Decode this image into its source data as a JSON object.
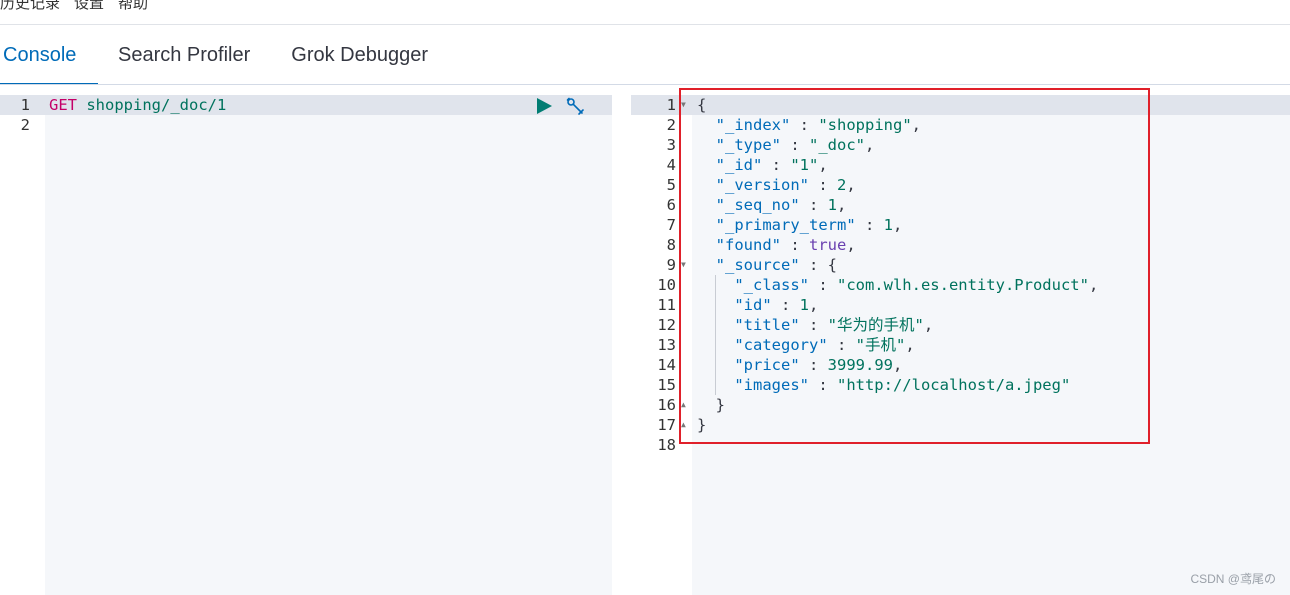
{
  "top_menu": {
    "items": [
      "历史记录",
      "设置",
      "帮助"
    ]
  },
  "tabs": [
    {
      "label": "Console",
      "active": true
    },
    {
      "label": "Search Profiler",
      "active": false
    },
    {
      "label": "Grok Debugger",
      "active": false
    }
  ],
  "request": {
    "lines": [
      "1",
      "2"
    ],
    "method": "GET",
    "path": "shopping/_doc/1"
  },
  "response": {
    "line_numbers": [
      "1",
      "2",
      "3",
      "4",
      "5",
      "6",
      "7",
      "8",
      "9",
      "10",
      "11",
      "12",
      "13",
      "14",
      "15",
      "16",
      "17",
      "18"
    ],
    "index_key": "\"_index\"",
    "index_val": "\"shopping\"",
    "type_key": "\"_type\"",
    "type_val": "\"_doc\"",
    "id_key": "\"_id\"",
    "id_val": "\"1\"",
    "version_key": "\"_version\"",
    "version_val": "2",
    "seq_no_key": "\"_seq_no\"",
    "seq_no_val": "1",
    "primary_term_key": "\"_primary_term\"",
    "primary_term_val": "1",
    "found_key": "\"found\"",
    "found_val": "true",
    "source_key": "\"_source\"",
    "class_key": "\"_class\"",
    "class_val": "\"com.wlh.es.entity.Product\"",
    "src_id_key": "\"id\"",
    "src_id_val": "1",
    "title_key": "\"title\"",
    "title_val": "\"华为的手机\"",
    "category_key": "\"category\"",
    "category_val": "\"手机\"",
    "price_key": "\"price\"",
    "price_val": "3999.99",
    "images_key": "\"images\"",
    "images_val": "\"http://localhost/a.jpeg\""
  },
  "colors": {
    "accent": "#006bb8",
    "run_button": "#017d73",
    "highlight": "#e0202a"
  },
  "icons": {
    "run": "play-icon",
    "settings": "wrench-icon"
  },
  "watermark": "CSDN @鸢尾の"
}
